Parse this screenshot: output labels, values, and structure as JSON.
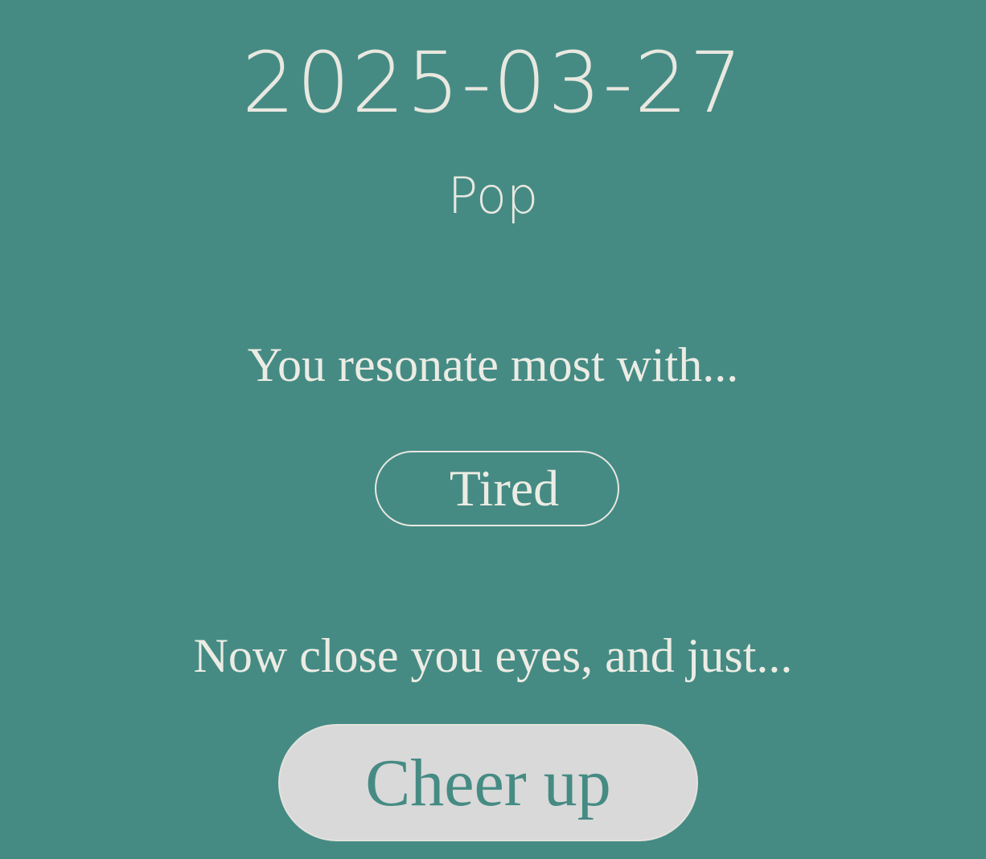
{
  "header": {
    "date": "2025-03-27",
    "genre": "Pop"
  },
  "result": {
    "intro_text": "You resonate most with...",
    "mood": "Tired"
  },
  "prompt": {
    "instruction_text": "Now close you eyes, and just...",
    "action_label": "Cheer up"
  },
  "colors": {
    "background": "#458b84",
    "text": "#e8e8e0",
    "button_fill": "#d9d9d9",
    "button_text": "#458b84"
  }
}
